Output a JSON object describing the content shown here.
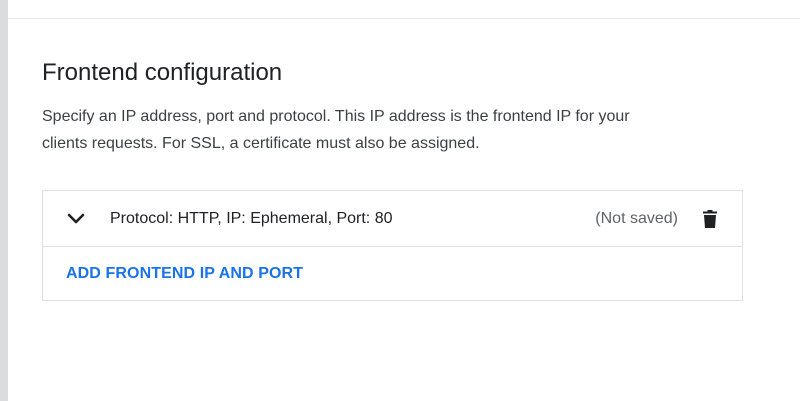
{
  "section": {
    "title": "Frontend configuration",
    "description_line1": "Specify an IP address, port and protocol. This IP address is the frontend IP for your",
    "description_line2": "clients requests. For SSL, a certificate must also be assigned."
  },
  "frontend_items": [
    {
      "label": "Protocol: HTTP, IP: Ephemeral, Port: 80",
      "status": "(Not saved)",
      "expand_icon": "chevron-down-icon",
      "delete_icon": "trash-icon"
    }
  ],
  "add_button": {
    "label": "ADD FRONTEND IP AND PORT"
  },
  "colors": {
    "accent": "#1a73e8",
    "text": "#202124",
    "muted": "#5f6368",
    "border": "#e0e0e0"
  }
}
